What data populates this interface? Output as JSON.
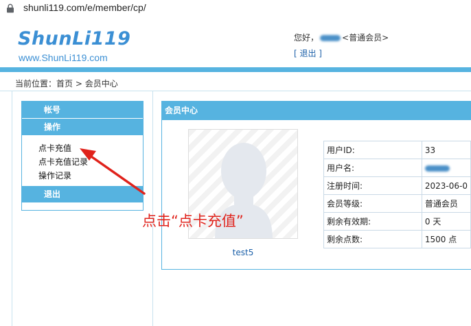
{
  "browser": {
    "url": "shunli119.com/e/member/cp/"
  },
  "header": {
    "logo_text": "ShunLi119",
    "logo_url_text": "www.ShunLi119.com",
    "greeting_prefix": "您好，",
    "greeting_suffix": "<普通会员>",
    "logout_link": "[ 退出 ]"
  },
  "breadcrumb": {
    "label": "当前位置：",
    "home": "首页",
    "separator": " > ",
    "current": "会员中心"
  },
  "sidebar": {
    "section_account": "帐号",
    "section_ops": "操作",
    "links": [
      "点卡充值",
      "点卡充值记录",
      "操作记录"
    ],
    "section_logout": "退出"
  },
  "main": {
    "title": "会员中心",
    "username": "test5",
    "info_rows": [
      {
        "label": "用户ID:",
        "value": "33"
      },
      {
        "label": "用户名:",
        "value": ""
      },
      {
        "label": "注册时间:",
        "value": "2023-06-0"
      },
      {
        "label": "会员等级:",
        "value": "普通会员"
      },
      {
        "label": "剩余有效期:",
        "value": "0 天"
      },
      {
        "label": "剩余点数:",
        "value": "1500 点"
      }
    ]
  },
  "annotation": {
    "text": "点击“点卡充值”",
    "color": "#e0221b"
  },
  "colors": {
    "accent": "#56b3e0",
    "logo": "#3b8fd4",
    "link": "#1a5fa8"
  }
}
